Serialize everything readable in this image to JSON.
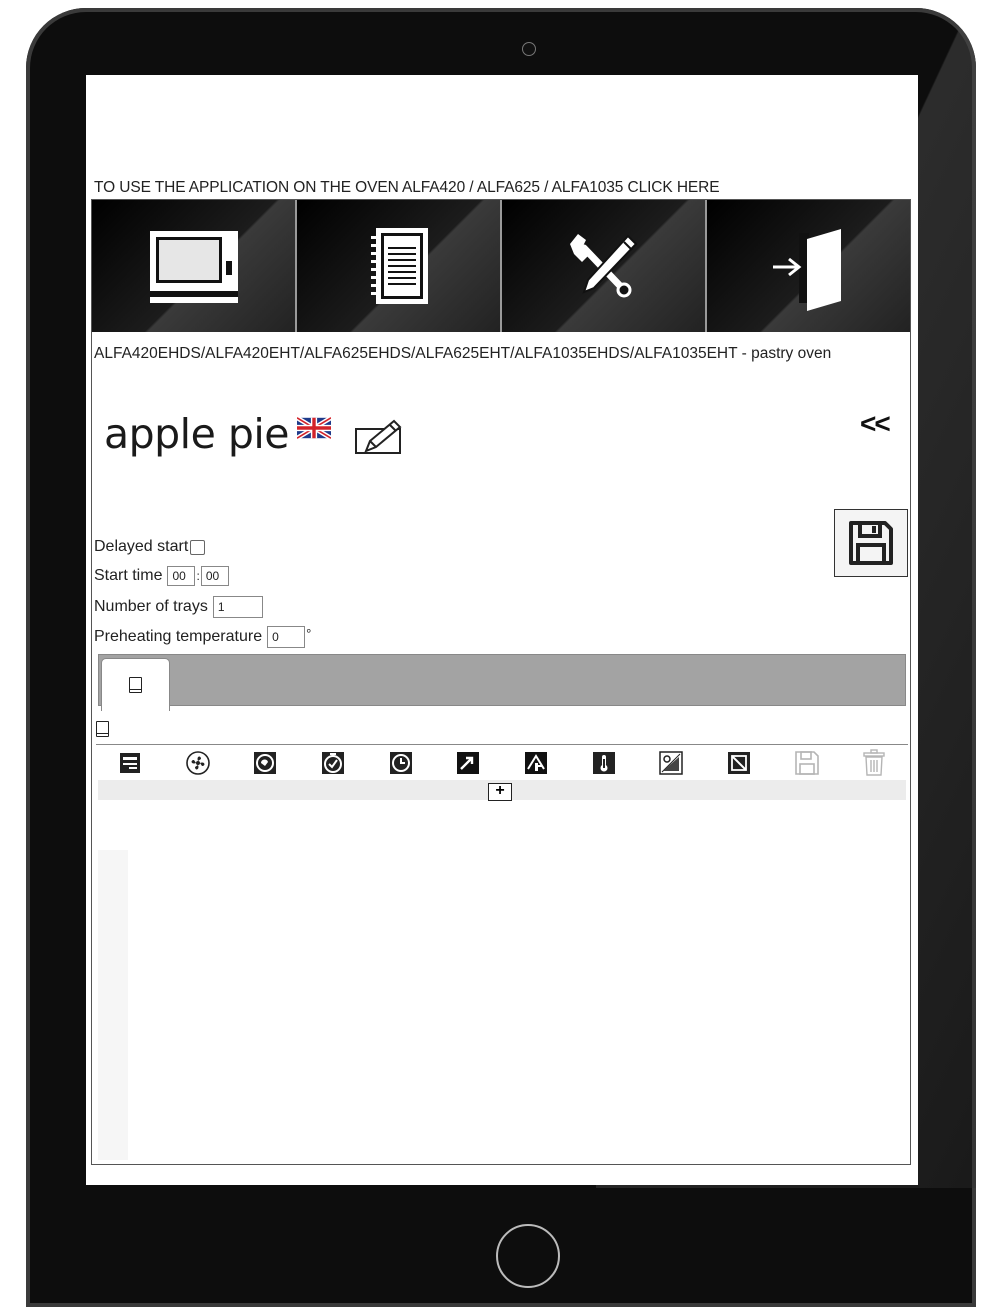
{
  "header": {
    "oven_link": "TO USE THE APPLICATION ON THE OVEN ALFA420 / ALFA625 / ALFA1035 CLICK HERE"
  },
  "nav_tiles": [
    {
      "icon": "oven-icon"
    },
    {
      "icon": "recipe-book-icon"
    },
    {
      "icon": "tools-icon"
    },
    {
      "icon": "logout-icon"
    }
  ],
  "model_line": "ALFA420EHDS/ALFA420EHT/ALFA625EHDS/ALFA625EHT/ALFA1035EHDS/ALFA1035EHT - pastry oven",
  "recipe": {
    "name": "apple pie",
    "language_flag": "uk-flag-icon",
    "back_label": "<<"
  },
  "form": {
    "delayed_start_label": "Delayed start",
    "start_time_label": "Start time",
    "start_hours": "00",
    "time_separator": ":",
    "start_minutes": "00",
    "trays_label": "Number of trays",
    "trays_value": "1",
    "preheat_label": "Preheating temperature",
    "preheat_value": "0",
    "preheat_unit": "°"
  },
  "toolbar": {
    "icons": [
      "dry-icon",
      "fan-icon",
      "humidity-icon",
      "core-timer-icon",
      "clock-icon",
      "steam-up-icon",
      "steam-valve-icon",
      "thermometer-icon",
      "fan-speed-icon",
      "no-humidity-icon",
      "save-phase-icon",
      "trash-icon"
    ],
    "add_label": "+"
  },
  "colors": {
    "tablet_body": "#0d0d0d",
    "tabs_bar": "#a3a3a3"
  }
}
